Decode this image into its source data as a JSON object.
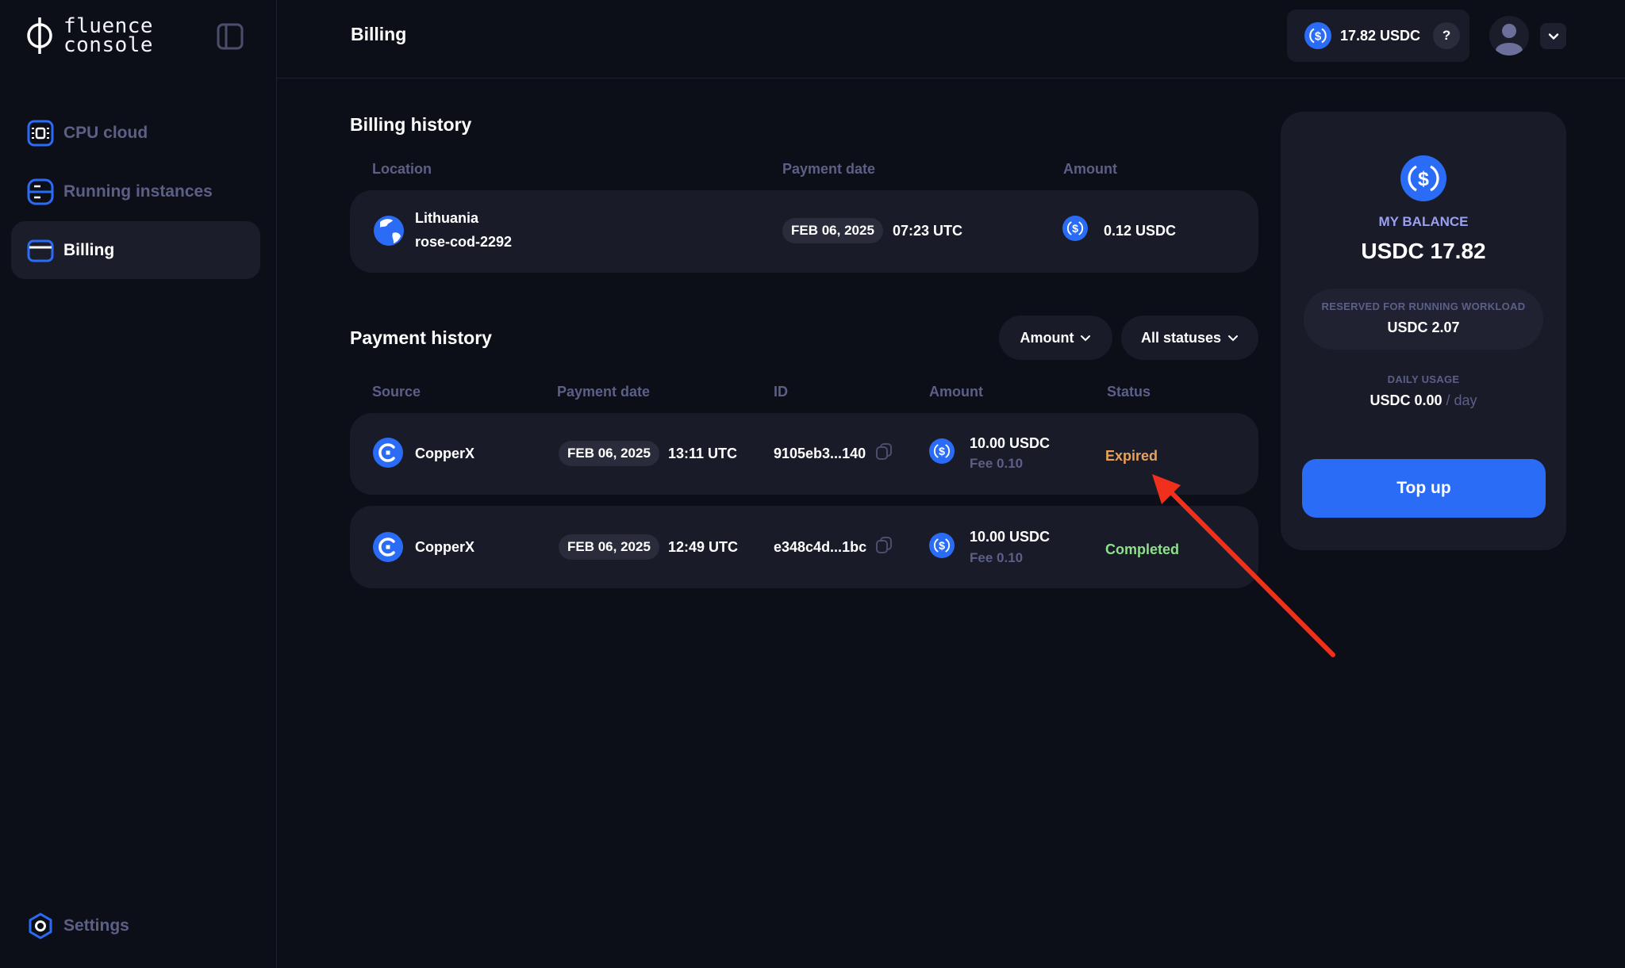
{
  "app": {
    "logo_line1": "fluence",
    "logo_line2": "console"
  },
  "sidebar": {
    "items": [
      {
        "label": "CPU cloud",
        "icon": "cpu-icon",
        "active": false
      },
      {
        "label": "Running instances",
        "icon": "instances-icon",
        "active": false
      },
      {
        "label": "Billing",
        "icon": "card-icon",
        "active": true
      }
    ],
    "settings_label": "Settings"
  },
  "header": {
    "title": "Billing",
    "balance": "17.82 USDC",
    "help": "?"
  },
  "billing_history": {
    "title": "Billing history",
    "columns": [
      "Location",
      "Payment date",
      "Amount"
    ],
    "rows": [
      {
        "location": "Lithuania",
        "instance": "rose-cod-2292",
        "date": "FEB 06, 2025",
        "time": "07:23 UTC",
        "amount": "0.12 USDC"
      }
    ]
  },
  "payment_history": {
    "title": "Payment history",
    "filters": {
      "amount": "Amount",
      "status": "All statuses"
    },
    "columns": [
      "Source",
      "Payment date",
      "ID",
      "Amount",
      "Status"
    ],
    "rows": [
      {
        "source": "CopperX",
        "date": "FEB 06, 2025",
        "time": "13:11 UTC",
        "id": "9105eb3...140",
        "amount": "10.00 USDC",
        "fee": "Fee 0.10",
        "status": "Expired",
        "status_color": "#e8a25a"
      },
      {
        "source": "CopperX",
        "date": "FEB 06, 2025",
        "time": "12:49 UTC",
        "id": "e348c4d...1bc",
        "amount": "10.00 USDC",
        "fee": "Fee 0.10",
        "status": "Completed",
        "status_color": "#8ee08a"
      }
    ]
  },
  "balance_card": {
    "label": "MY BALANCE",
    "value": "USDC 17.82",
    "reserved_label": "RESERVED FOR RUNNING WORKLOAD",
    "reserved_value": "USDC 2.07",
    "daily_label": "DAILY USAGE",
    "daily_value": "USDC 0.00",
    "daily_unit": " / day",
    "topup_label": "Top up"
  },
  "colors": {
    "accent": "#2b6cf6",
    "background": "#0d0f18",
    "card": "#191b28",
    "muted": "#5c5f86",
    "annotation": "#f0301c"
  }
}
